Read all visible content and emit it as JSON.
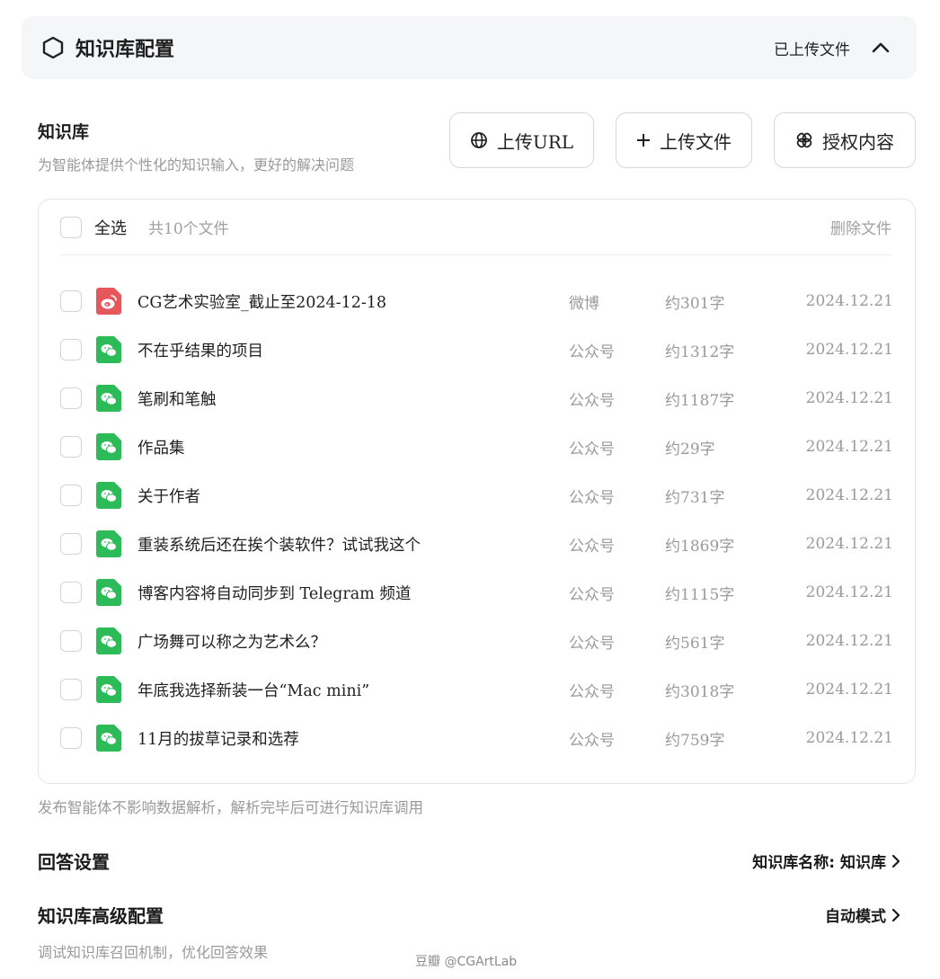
{
  "header": {
    "title": "知识库配置",
    "status": "已上传文件",
    "icon": "hexagon-icon",
    "toggle_icon": "chevron-up-icon"
  },
  "knowledge_base": {
    "title": "知识库",
    "description": "为智能体提供个性化的知识输入，更好的解决问题",
    "buttons": {
      "upload_url": "上传URL",
      "upload_file": "上传文件",
      "authorize": "授权内容"
    }
  },
  "file_list": {
    "select_all": "全选",
    "count": "共10个文件",
    "delete": "删除文件",
    "files": [
      {
        "name": "CG艺术实验室_截止至2024-12-18",
        "source": "微博",
        "words": "约301字",
        "date": "2024.12.21",
        "icon": "weibo-icon",
        "color": "#e5575a"
      },
      {
        "name": "不在乎结果的项目",
        "source": "公众号",
        "words": "约1312字",
        "date": "2024.12.21",
        "icon": "wechat-icon",
        "color": "#2dbb5a"
      },
      {
        "name": "笔刷和笔触",
        "source": "公众号",
        "words": "约1187字",
        "date": "2024.12.21",
        "icon": "wechat-icon",
        "color": "#2dbb5a"
      },
      {
        "name": "作品集",
        "source": "公众号",
        "words": "约29字",
        "date": "2024.12.21",
        "icon": "wechat-icon",
        "color": "#2dbb5a"
      },
      {
        "name": "关于作者",
        "source": "公众号",
        "words": "约731字",
        "date": "2024.12.21",
        "icon": "wechat-icon",
        "color": "#2dbb5a"
      },
      {
        "name": "重装系统后还在挨个装软件？试试我这个",
        "source": "公众号",
        "words": "约1869字",
        "date": "2024.12.21",
        "icon": "wechat-icon",
        "color": "#2dbb5a"
      },
      {
        "name": "博客内容将自动同步到 Telegram 频道",
        "source": "公众号",
        "words": "约1115字",
        "date": "2024.12.21",
        "icon": "wechat-icon",
        "color": "#2dbb5a"
      },
      {
        "name": "广场舞可以称之为艺术么？",
        "source": "公众号",
        "words": "约561字",
        "date": "2024.12.21",
        "icon": "wechat-icon",
        "color": "#2dbb5a"
      },
      {
        "name": "年底我选择新装一台“Mac mini”",
        "source": "公众号",
        "words": "约3018字",
        "date": "2024.12.21",
        "icon": "wechat-icon",
        "color": "#2dbb5a"
      },
      {
        "name": "11月的拔草记录和选荐",
        "source": "公众号",
        "words": "约759字",
        "date": "2024.12.21",
        "icon": "wechat-icon",
        "color": "#2dbb5a"
      }
    ]
  },
  "publish_note": "发布智能体不影响数据解析，解析完毕后可进行知识库调用",
  "answer_settings": {
    "label": "回答设置",
    "value": "知识库名称: 知识库"
  },
  "advanced": {
    "label": "知识库高级配置",
    "value": "自动模式",
    "description": "调试知识库召回机制，优化回答效果"
  },
  "watermark": "豆瓣  @CGArtLab"
}
